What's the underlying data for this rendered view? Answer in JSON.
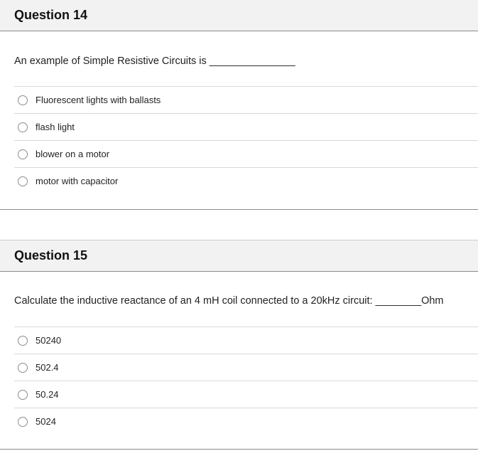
{
  "questions": [
    {
      "title": "Question 14",
      "text": "An example of Simple Resistive Circuits is _______________",
      "options": [
        "Fluorescent lights with ballasts",
        "flash light",
        "blower on a motor",
        "motor with capacitor"
      ]
    },
    {
      "title": "Question 15",
      "text": "Calculate the inductive reactance of an 4 mH coil connected to a 20kHz circuit: ________Ohm",
      "options": [
        "50240",
        "502.4",
        "50.24",
        "5024"
      ]
    }
  ]
}
